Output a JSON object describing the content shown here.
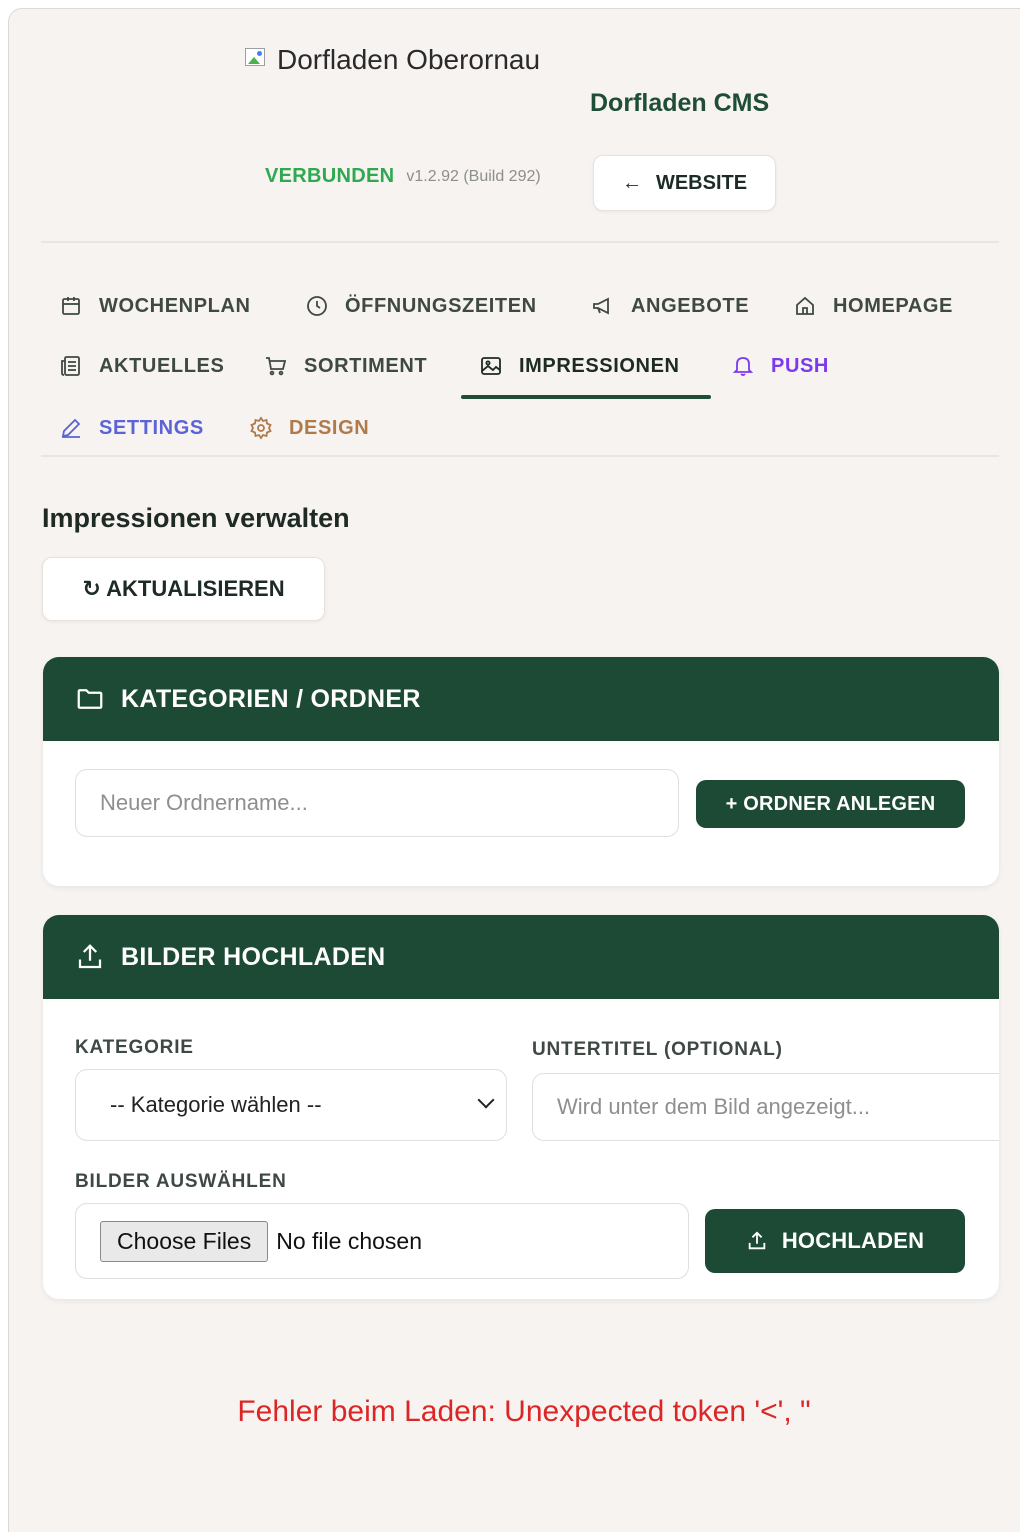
{
  "header": {
    "logo_alt": "Dorfladen Oberornau",
    "cms_title": "Dorfladen CMS",
    "status": "VERBUNDEN",
    "version": "v1.2.92 (Build 292)",
    "website_button": "WEBSITE"
  },
  "nav": {
    "items": [
      {
        "label": "WOCHENPLAN",
        "icon": "calendar-icon"
      },
      {
        "label": "ÖFFNUNGSZEITEN",
        "icon": "clock-icon"
      },
      {
        "label": "ANGEBOTE",
        "icon": "megaphone-icon"
      },
      {
        "label": "HOMEPAGE",
        "icon": "home-icon"
      },
      {
        "label": "AKTUELLES",
        "icon": "newspaper-icon"
      },
      {
        "label": "SORTIMENT",
        "icon": "cart-icon"
      },
      {
        "label": "IMPRESSIONEN",
        "icon": "image-icon",
        "active": true
      },
      {
        "label": "PUSH",
        "icon": "bell-icon"
      },
      {
        "label": "SETTINGS",
        "icon": "pencil-icon"
      },
      {
        "label": "DESIGN",
        "icon": "gear-icon"
      }
    ]
  },
  "main": {
    "title": "Impressionen verwalten",
    "refresh_button": "↻ AKTUALISIEREN",
    "categories_card": {
      "title": "KATEGORIEN / ORDNER",
      "folder_input_placeholder": "Neuer Ordnername...",
      "add_button": "+ ORDNER ANLEGEN"
    },
    "upload_card": {
      "title": "BILDER HOCHLADEN",
      "category_label": "KATEGORIE",
      "category_selected": "-- Kategorie wählen --",
      "subtitle_label": "UNTERTITEL (OPTIONAL)",
      "subtitle_placeholder": "Wird unter dem Bild angezeigt...",
      "files_label": "BILDER AUSWÄHLEN",
      "choose_files": "Choose Files",
      "no_file": "No file chosen",
      "upload_button": "HOCHLADEN"
    },
    "error_message": "Fehler beim Laden: Unexpected token '<', \""
  },
  "colors": {
    "brand_green": "#1d4a35",
    "status_green": "#2fa84f",
    "error_red": "#dc2626",
    "push_purple": "#7c3aed",
    "settings_blue": "#5b63d6",
    "design_brown": "#b07a4a"
  }
}
